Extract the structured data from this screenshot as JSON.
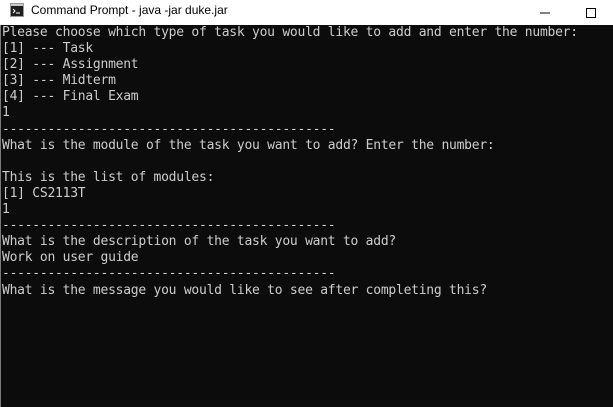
{
  "window": {
    "title": "Command Prompt - java  -jar duke.jar",
    "icon": "cmd-icon",
    "minimize_icon": "minimize-icon",
    "maximize_icon": "maximize-icon",
    "colors": {
      "titlebar_bg": "#ffffff",
      "console_bg": "#0c0c0c",
      "console_text": "#cccccc"
    }
  },
  "console": {
    "lines": [
      "Please choose which type of task you would like to add and enter the number:",
      "[1] --- Task",
      "[2] --- Assignment",
      "[3] --- Midterm",
      "[4] --- Final Exam",
      "1",
      "--------------------------------------------",
      "What is the module of the task you want to add? Enter the number:",
      "",
      "This is the list of modules:",
      "[1] CS2113T",
      "1",
      "--------------------------------------------",
      "What is the description of the task you want to add?",
      "Work on user guide",
      "--------------------------------------------",
      "What is the message you would like to see after completing this?"
    ]
  }
}
